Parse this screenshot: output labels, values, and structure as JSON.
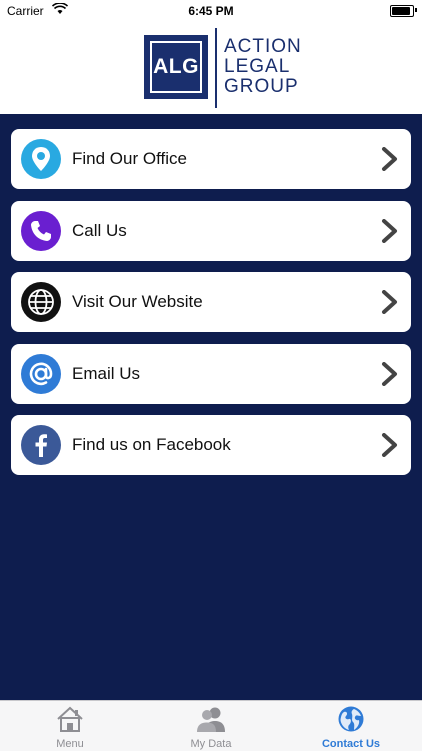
{
  "status_bar": {
    "carrier": "Carrier",
    "time": "6:45 PM"
  },
  "header": {
    "logo_abbrev": "ALG",
    "logo_lines": [
      "ACTION",
      "LEGAL",
      "GROUP"
    ]
  },
  "menu": [
    {
      "label": "Find Our Office",
      "icon": "location-pin-icon",
      "color": "#29a9e1"
    },
    {
      "label": "Call Us",
      "icon": "phone-icon",
      "color": "#6a1fd0"
    },
    {
      "label": "Visit Our Website",
      "icon": "globe-icon",
      "color": "#111111"
    },
    {
      "label": "Email Us",
      "icon": "at-sign-icon",
      "color": "#2f7bd6"
    },
    {
      "label": "Find us on Facebook",
      "icon": "facebook-icon",
      "color": "#3b5998"
    }
  ],
  "tabbar": {
    "tabs": [
      {
        "label": "Menu",
        "icon": "house-icon",
        "active": false
      },
      {
        "label": "My Data",
        "icon": "users-icon",
        "active": false
      },
      {
        "label": "Contact Us",
        "icon": "globe-icon",
        "active": true
      }
    ]
  },
  "colors": {
    "background": "#0e1d4e",
    "brand": "#1a2f6e",
    "tab_active": "#2f7bd6"
  }
}
